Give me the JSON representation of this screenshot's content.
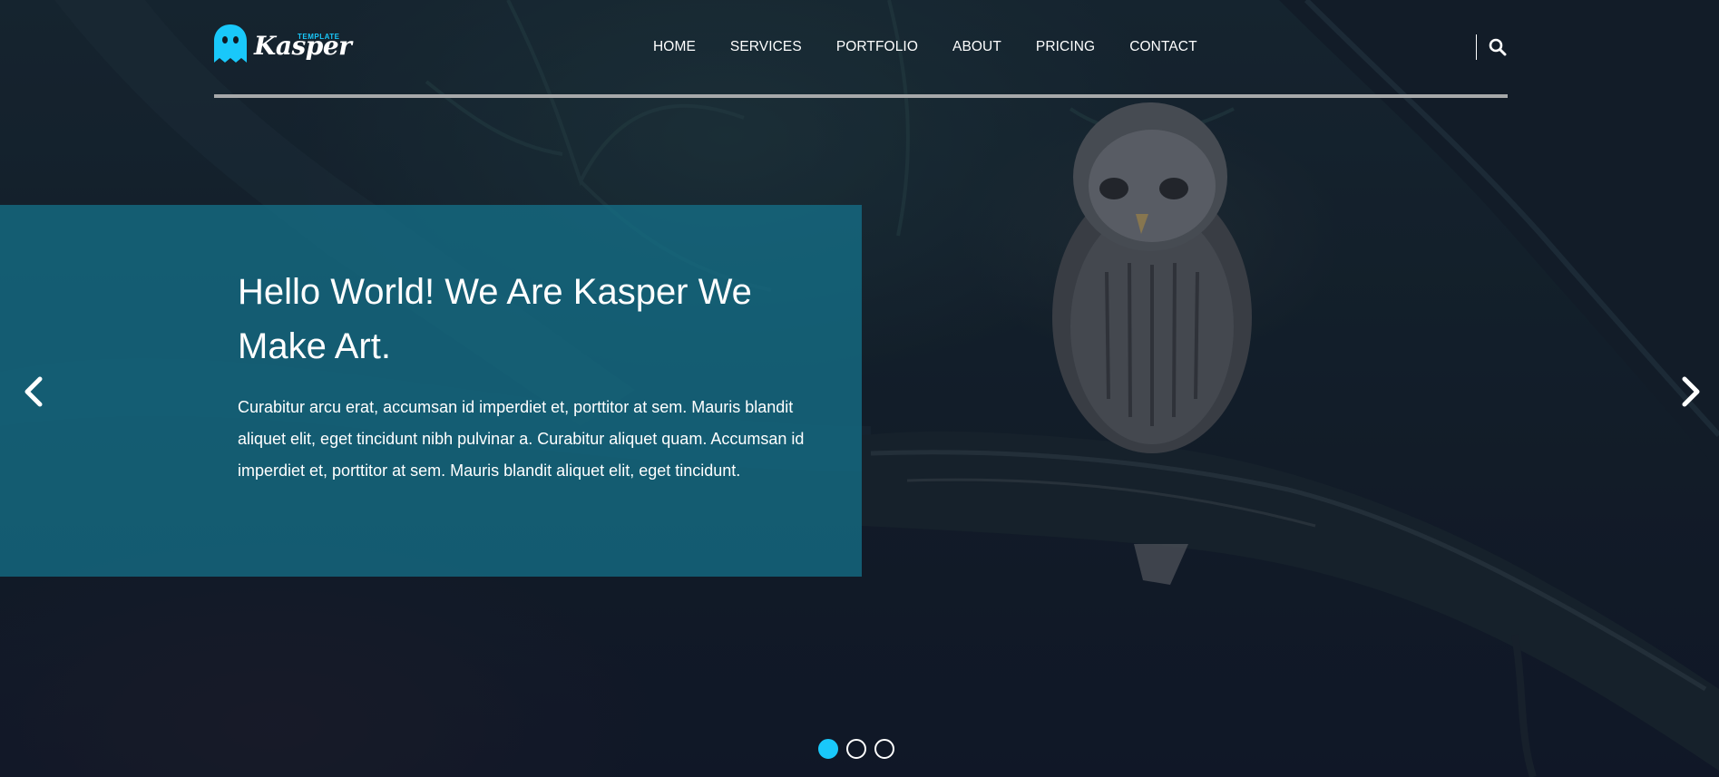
{
  "brand": {
    "name": "Kasper",
    "tag": "TEMPLATE",
    "logo_icon": "ghost-icon",
    "accent_color": "#19c8fa"
  },
  "nav": {
    "items": [
      {
        "label": "HOME"
      },
      {
        "label": "SERVICES"
      },
      {
        "label": "PORTFOLIO"
      },
      {
        "label": "ABOUT"
      },
      {
        "label": "PRICING"
      },
      {
        "label": "CONTACT"
      }
    ],
    "search_icon": "search-icon"
  },
  "slider": {
    "title": "Hello World! We Are Kasper We Make Art.",
    "text": "Curabitur arcu erat, accumsan id imperdiet et, porttitor at sem. Mauris blandit aliquet elit, eget tincidunt nibh pulvinar a. Curabitur aliquet quam. Accumsan id imperdiet et, porttitor at sem. Mauris blandit aliquet elit, eget tincidunt.",
    "prev_icon": "chevron-left-icon",
    "next_icon": "chevron-right-icon",
    "bullets": [
      {
        "active": true
      },
      {
        "active": false
      },
      {
        "active": false
      }
    ]
  }
}
